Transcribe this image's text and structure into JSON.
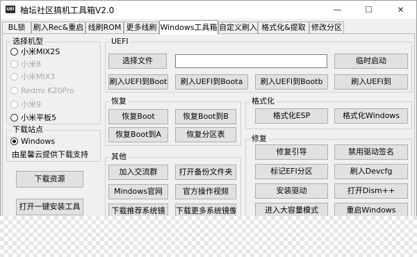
{
  "window": {
    "title": "柚坛社区搞机工具箱V2.0",
    "icon_text": "UEI",
    "minimize_glyph": "—",
    "maximize_glyph": "☐",
    "close_glyph": "✕"
  },
  "tabs": [
    {
      "label": "BL锁"
    },
    {
      "label": "刷入Rec&重启"
    },
    {
      "label": "线刷ROM"
    },
    {
      "label": "更多线刷"
    },
    {
      "label": "Windows工具箱",
      "active": true
    },
    {
      "label": "自定义刷入"
    },
    {
      "label": "格式化&提取"
    },
    {
      "label": "修改分区"
    }
  ],
  "model_group": {
    "title": "选择机型",
    "options": [
      {
        "label": "小米MIX2S",
        "enabled": true,
        "checked": false
      },
      {
        "label": "小米8",
        "enabled": false,
        "checked": false
      },
      {
        "label": "小米MIX3",
        "enabled": false,
        "checked": false
      },
      {
        "label": "Redmi K20Pro",
        "enabled": false,
        "checked": false
      },
      {
        "label": "小米9",
        "enabled": false,
        "checked": false
      },
      {
        "label": "小米平板5",
        "enabled": true,
        "checked": false
      }
    ]
  },
  "download_group": {
    "title": "下载站点",
    "option": "Windows",
    "note": "由星馨云提供下载支持"
  },
  "left_buttons": {
    "download": "下载资源",
    "install": "打开一键安装工具"
  },
  "uefi": {
    "title": "UEFI",
    "select_file": "选择文件",
    "file_path": "",
    "temp_boot": "临时启动",
    "flash_boot": "刷入UEFI到Boot",
    "flash_boota": "刷入UEFI到Boota",
    "flash_bootb": "刷入UEFI到Bootb",
    "flash_to": "刷入UEFI到"
  },
  "restore": {
    "title": "恢复",
    "boot": "恢复Boot",
    "boot_b": "恢复Boot到B",
    "boot_a": "恢复Boot到A",
    "partition": "恢复分区表"
  },
  "format": {
    "title": "格式化",
    "esp": "格式化ESP",
    "windows": "格式化Windows"
  },
  "other": {
    "title": "其他",
    "join_group": "加入交流群",
    "open_backup": "打开备份文件夹",
    "windows_site": "Mindows官网",
    "official_video": "官方操作视频",
    "download_image": "下载推荐系统镜",
    "download_more": "下载更多系统镜像"
  },
  "repair": {
    "title": "修复",
    "boot_repair": "修复引导",
    "disable_sig": "禁用驱动签名",
    "mark_efi": "标记EFI分区",
    "flash_devcfg": "刷入Devcfg",
    "install_driver": "安装驱动",
    "open_dism": "打开Dism++",
    "mass_storage": "进入大容量模式",
    "reboot_windows": "重启Windows"
  }
}
